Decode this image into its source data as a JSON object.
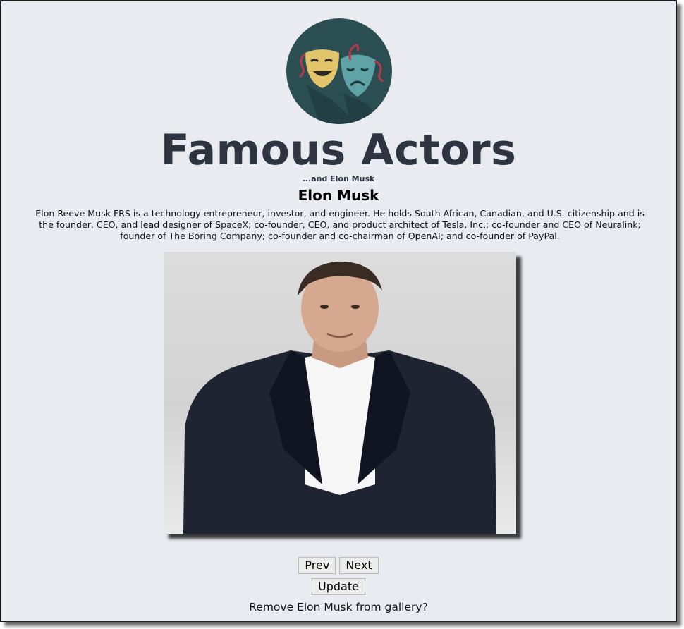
{
  "header": {
    "logo_icon": "theater-masks-icon",
    "title": "Famous Actors",
    "subtitle": "...and Elon Musk"
  },
  "profile": {
    "name": "Elon Musk",
    "bio": "Elon Reeve Musk FRS is a technology entrepreneur, investor, and engineer. He holds South African, Canadian, and U.S. citizenship and is the founder, CEO, and lead designer of SpaceX; co-founder, CEO, and product architect of Tesla, Inc.; co-founder and CEO of Neuralink; founder of The Boring Company; co-founder and co-chairman of OpenAI; and co-founder of PayPal.",
    "photo_alt": "Elon Musk"
  },
  "controls": {
    "prev_label": "Prev",
    "next_label": "Next",
    "update_label": "Update",
    "remove_text": "Remove Elon Musk from gallery?"
  },
  "colors": {
    "page_background": "#e9ebf0",
    "title_color": "#2e3440",
    "logo_circle": "#2a4e52",
    "comedy_mask": "#e2c56a",
    "tragedy_mask": "#5fa3a6",
    "ribbon": "#b33a4a"
  }
}
